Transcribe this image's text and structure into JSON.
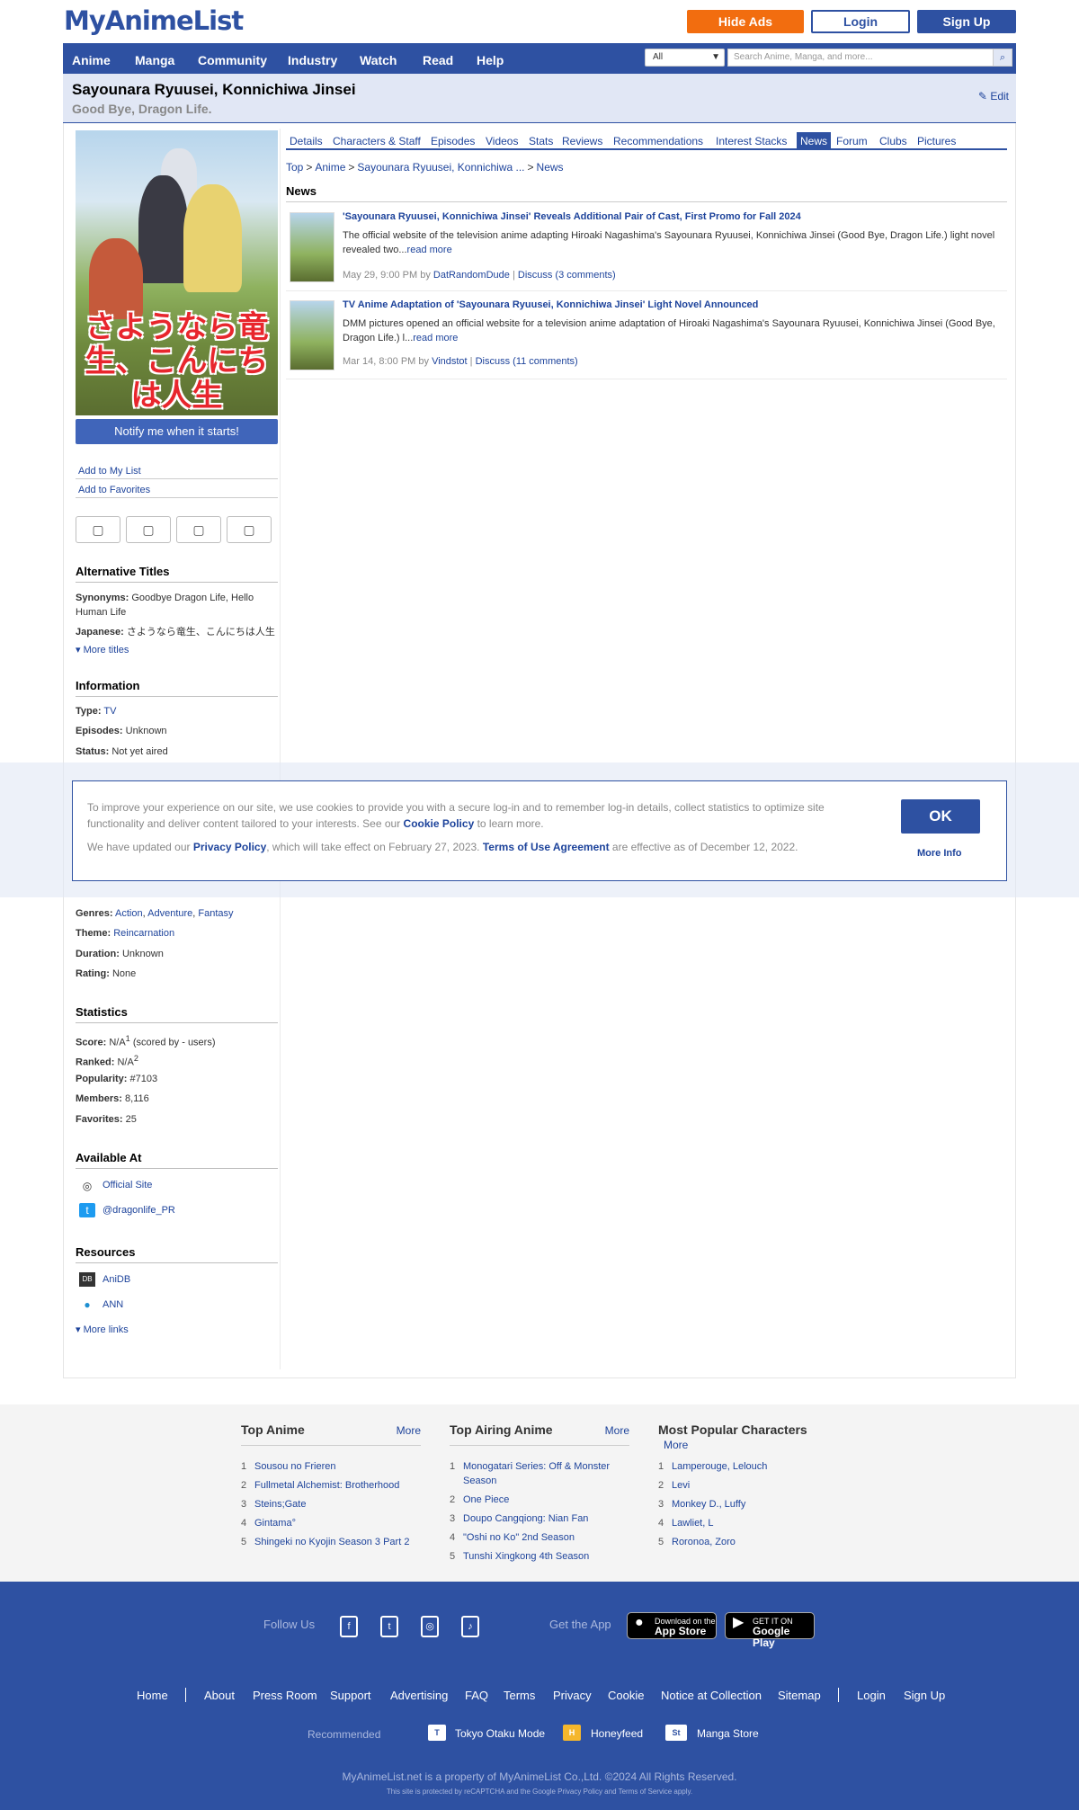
{
  "header": {
    "logo": "MyAnimeList",
    "hide_ads": "Hide Ads",
    "login": "Login",
    "signup": "Sign Up"
  },
  "nav": {
    "items": [
      "Anime",
      "Manga",
      "Community",
      "Industry",
      "Watch",
      "Read",
      "Help"
    ],
    "search_scope": "All",
    "search_placeholder": "Search Anime, Manga, and more..."
  },
  "title": {
    "main": "Sayounara Ryuusei, Konnichiwa Jinsei",
    "english": "Good Bye, Dragon Life.",
    "edit": "Edit"
  },
  "sidebar": {
    "poster_text": "さようなら竜生、こんにちは人生",
    "notify": "Notify me when it starts!",
    "add_list": "Add to My List",
    "add_fav": "Add to Favorites",
    "alt_titles_h": "Alternative Titles",
    "synonyms_label": "Synonyms:",
    "synonyms": "Goodbye Dragon Life, Hello Human Life",
    "japanese_label": "Japanese:",
    "japanese": "さようなら竜生、こんにちは人生",
    "more_titles": "More titles",
    "info_h": "Information",
    "type_label": "Type:",
    "type": "TV",
    "episodes_label": "Episodes:",
    "episodes": "Unknown",
    "status_label": "Status:",
    "status": "Not yet aired",
    "genres_label": "Genres:",
    "genres": [
      "Action",
      "Adventure",
      "Fantasy"
    ],
    "theme_label": "Theme:",
    "theme": "Reincarnation",
    "duration_label": "Duration:",
    "duration": "Unknown",
    "rating_label": "Rating:",
    "rating": "None",
    "stats_h": "Statistics",
    "score_label": "Score:",
    "score": "N/A",
    "score_sup": "1",
    "score_suffix": "(scored by - users)",
    "ranked_label": "Ranked:",
    "ranked": "N/A",
    "ranked_sup": "2",
    "popularity_label": "Popularity:",
    "popularity": "#7103",
    "members_label": "Members:",
    "members": "8,116",
    "favorites_label": "Favorites:",
    "favorites": "25",
    "available_h": "Available At",
    "official_site": "Official Site",
    "twitter": "@dragonlife_PR",
    "resources_h": "Resources",
    "anidb": "AniDB",
    "ann": "ANN",
    "more_links": "More links"
  },
  "tabs": [
    "Details",
    "Characters & Staff",
    "Episodes",
    "Videos",
    "Stats",
    "Reviews",
    "Recommendations",
    "Interest Stacks",
    "News",
    "Forum",
    "Clubs",
    "Pictures"
  ],
  "active_tab": "News",
  "breadcrumb": [
    "Top",
    "Anime",
    "Sayounara Ryuusei, Konnichiwa ...",
    "News"
  ],
  "news_heading": "News",
  "news": [
    {
      "title": "'Sayounara Ryuusei, Konnichiwa Jinsei' Reveals Additional Pair of Cast, First Promo for Fall 2024",
      "body": "The official website of the television anime adapting Hiroaki Nagashima's Sayounara Ryuusei, Konnichiwa Jinsei (Good Bye, Dragon Life.) light novel revealed two...",
      "read_more": "read more",
      "date": "May 29, 9:00 PM by",
      "author": "DatRandomDude",
      "discuss": "Discuss (3 comments)"
    },
    {
      "title": "TV Anime Adaptation of 'Sayounara Ryuusei, Konnichiwa Jinsei' Light Novel Announced",
      "body": "DMM pictures opened an official website for a television anime adaptation of Hiroaki Nagashima's Sayounara Ryuusei, Konnichiwa Jinsei (Good Bye, Dragon Life.) l...",
      "read_more": "read more",
      "date": "Mar 14, 8:00 PM by",
      "author": "Vindstot",
      "discuss": "Discuss (11 comments)"
    }
  ],
  "cookie": {
    "text1_a": "To improve your experience on our site, we use cookies to provide you with a secure log-in and to remember log-in details, collect statistics to optimize site functionality and deliver content tailored to your interests. See our",
    "cookie_policy": "Cookie Policy",
    "text1_b": "to learn more.",
    "text2_a": "We have updated our",
    "privacy_policy": "Privacy Policy",
    "text2_b": ", which will take effect on February 27, 2023.",
    "tou": "Terms of Use Agreement",
    "text2_c": "are effective as of December 12, 2022.",
    "ok": "OK",
    "more_info": "More Info"
  },
  "footer_lists": [
    {
      "title": "Top Anime",
      "more": "More",
      "items": [
        "Sousou no Frieren",
        "Fullmetal Alchemist: Brotherhood",
        "Steins;Gate",
        "Gintama°",
        "Shingeki no Kyojin Season 3 Part 2"
      ]
    },
    {
      "title": "Top Airing Anime",
      "more": "More",
      "items": [
        "Monogatari Series: Off & Monster Season",
        "One Piece",
        "Doupo Cangqiong: Nian Fan",
        "\"Oshi no Ko\" 2nd Season",
        "Tunshi Xingkong 4th Season"
      ]
    },
    {
      "title": "Most Popular Characters",
      "more": "More",
      "items": [
        "Lamperouge, Lelouch",
        "Levi",
        "Monkey D., Luffy",
        "Lawliet, L",
        "Roronoa, Zoro"
      ]
    }
  ],
  "footer": {
    "follow_us": "Follow Us",
    "get_app": "Get the App",
    "app_store_small": "Download on the",
    "app_store": "App Store",
    "google_play_small": "GET IT ON",
    "google_play": "Google Play",
    "links": [
      "Home",
      "About",
      "Press Room",
      "Support",
      "Advertising",
      "FAQ",
      "Terms",
      "Privacy",
      "Cookie",
      "Notice at Collection",
      "Sitemap",
      "Login",
      "Sign Up"
    ],
    "recommended": "Recommended",
    "rec_items": [
      "Tokyo Otaku Mode",
      "Honeyfeed",
      "Manga Store"
    ],
    "copyright": "MyAnimeList.net is a property of MyAnimeList Co.,Ltd. ©2024 All Rights Reserved.",
    "recaptcha": "This site is protected by reCAPTCHA and the Google Privacy Policy and Terms of Service apply."
  },
  "colors": {
    "brand": "#2e51a2",
    "accent": "#f26d0f",
    "link": "#1d439b"
  }
}
